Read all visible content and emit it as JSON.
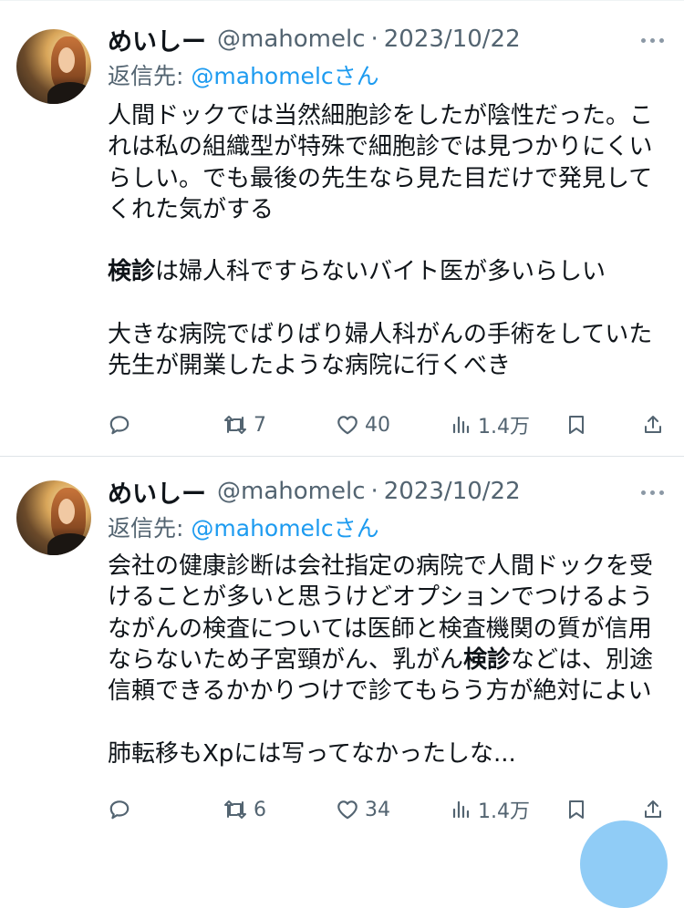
{
  "tweets": [
    {
      "display_name": "めいしー",
      "handle": "@mahomelc",
      "separator": "·",
      "date": "2023/10/22",
      "reply_prefix": "返信先:",
      "reply_mention": "@mahomelcさん",
      "body": [
        {
          "text": "人間ドックでは当然細胞診をしたが陰性だった。こ"
        },
        {
          "text": "れは私の組織型が特殊で細胞診では見つかりにくい"
        },
        {
          "text": "らしい。でも最後の先生なら見た目だけで発見して"
        },
        {
          "text": "くれた気がする"
        },
        {
          "text": ""
        },
        {
          "bold": "検診",
          "text": "は婦人科ですらないバイト医が多いらしい"
        },
        {
          "text": ""
        },
        {
          "text": "大きな病院でばりばり婦人科がんの手術をしていた"
        },
        {
          "text": "先生が開業したような病院に行くべき"
        }
      ],
      "stats": {
        "replies": "",
        "retweets": "7",
        "likes": "40",
        "views": "1.4万"
      }
    },
    {
      "display_name": "めいしー",
      "handle": "@mahomelc",
      "separator": "·",
      "date": "2023/10/22",
      "reply_prefix": "返信先:",
      "reply_mention": "@mahomelcさん",
      "body": [
        {
          "text": "会社の健康診断は会社指定の病院で人間ドックを受"
        },
        {
          "text": "けることが多いと思うけどオプションでつけるよう"
        },
        {
          "text": "ながんの検査については医師と検査機関の質が信用"
        },
        {
          "before": "ならないため子宮頸がん、乳がん",
          "bold": "検診",
          "text": "などは、別途"
        },
        {
          "text": "信頼できるかかりつけで診てもらう方が絶対によい"
        },
        {
          "text": ""
        },
        {
          "text": "肺転移もXpには写ってなかったしな..."
        }
      ],
      "stats": {
        "replies": "",
        "retweets": "6",
        "likes": "34",
        "views": "1.4万"
      }
    }
  ],
  "colors": {
    "accent": "#1d9bf0",
    "secondary_text": "#536471",
    "primary_text": "#0f1419"
  },
  "icons": [
    "more-icon",
    "reply-icon",
    "retweet-icon",
    "like-icon",
    "views-icon",
    "bookmark-icon",
    "share-icon"
  ]
}
